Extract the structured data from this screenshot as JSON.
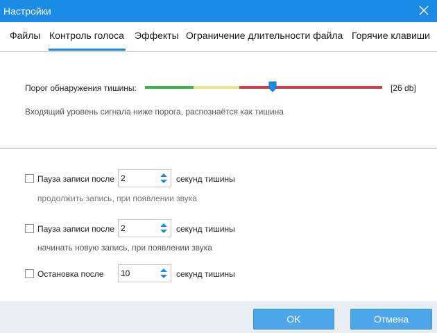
{
  "window": {
    "title": "Настройки"
  },
  "tabs": [
    {
      "label": "Файлы"
    },
    {
      "label": "Контроль голоса",
      "active": true
    },
    {
      "label": "Эффекты"
    },
    {
      "label": "Ограничение длительности файла"
    },
    {
      "label": "Горячие клавиши"
    }
  ],
  "silence": {
    "label": "Порог обнаружения тишины:",
    "value_text": "[26 db]",
    "hint": "Входящий уровень сигнала ниже порога, распознаётся как тишина",
    "slider_fraction": 0.54,
    "zones": [
      {
        "color": "#3cb44b"
      },
      {
        "color": "#e6e68a"
      },
      {
        "color": "#cc3f4a"
      }
    ],
    "thumb_color": "#1c8be6"
  },
  "options": [
    {
      "label": "Пауза записи после",
      "value": "2",
      "unit": "секунд тишины",
      "hint": "продолжить запись, при появлении звука",
      "checked": false
    },
    {
      "label": "Пауза записи после",
      "value": "2",
      "unit": "секунд тишины",
      "hint": "начинать новую запись, при появлении звука",
      "checked": false
    },
    {
      "label": "Остановка после",
      "value": "10",
      "unit": "секунд тишины",
      "checked": false
    }
  ],
  "buttons": {
    "ok": "OK",
    "cancel": "Отмена"
  },
  "colors": {
    "accent": "#1c8be6",
    "button": "#4ea6ea",
    "footer": "#e9eef5"
  }
}
